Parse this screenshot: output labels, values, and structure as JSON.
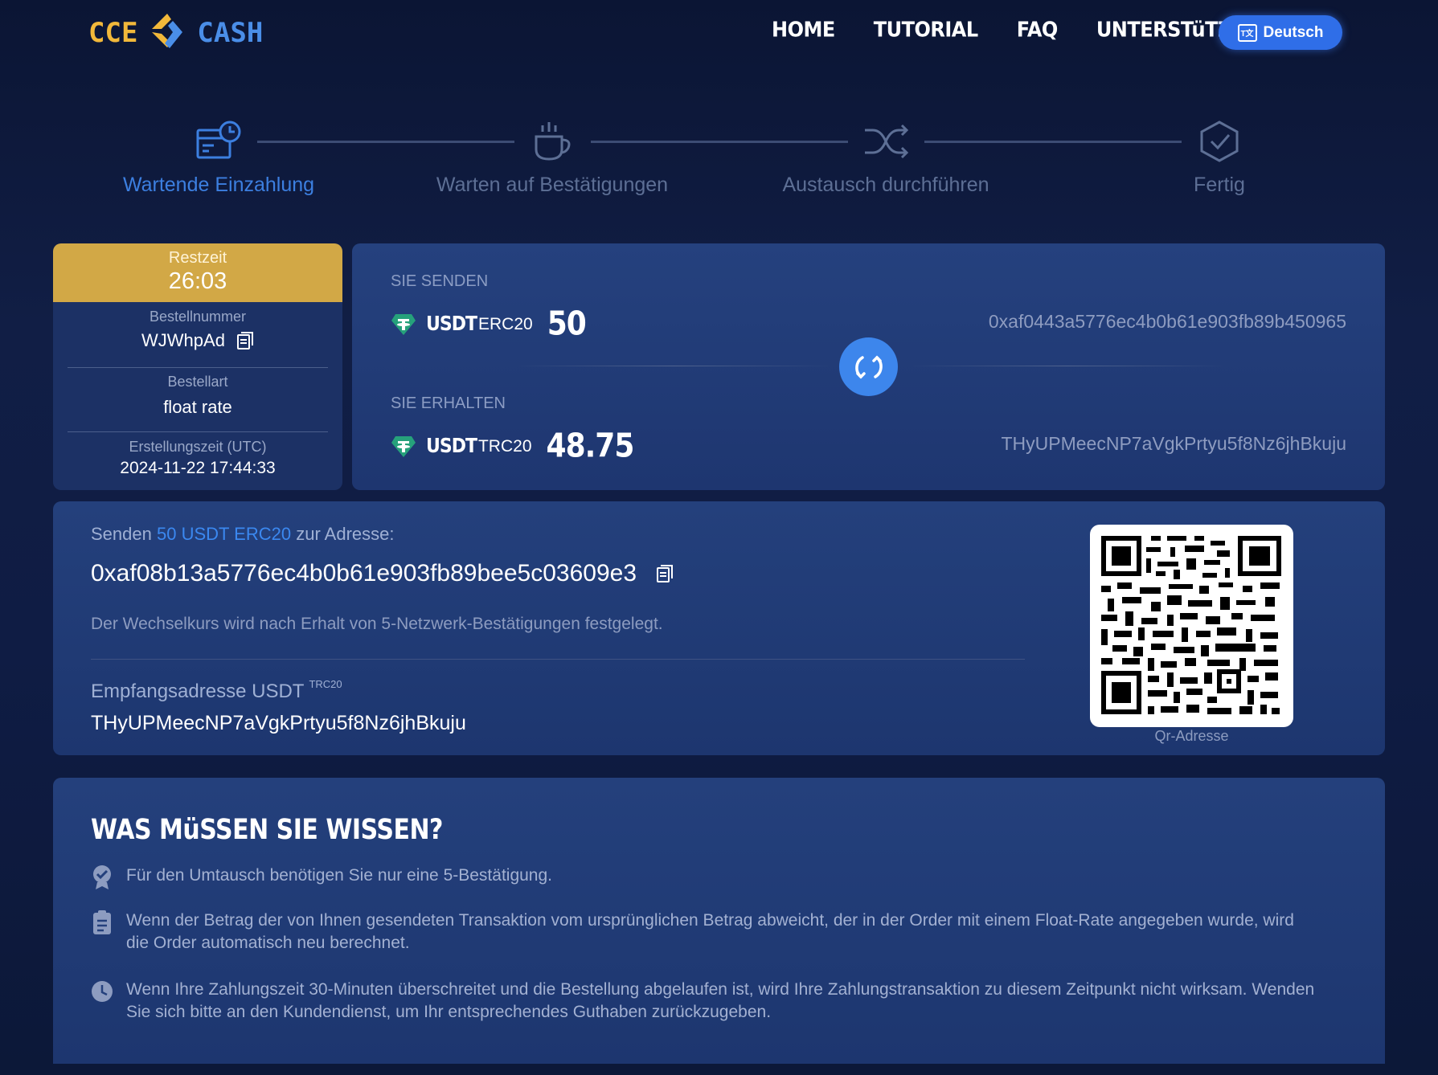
{
  "header": {
    "logo_left": "CCE",
    "logo_right": "CASH",
    "nav": [
      "HOME",
      "TUTORIAL",
      "FAQ",
      "UNTERSTüTZUNG"
    ],
    "language": "Deutsch",
    "language_icon": "language-icon"
  },
  "steps": [
    {
      "label": "Wartende Einzahlung",
      "icon": "deposit-clock-icon",
      "active": true
    },
    {
      "label": "Warten auf Bestätigungen",
      "icon": "coffee-cup-icon",
      "active": false
    },
    {
      "label": "Austausch durchführen",
      "icon": "shuffle-icon",
      "active": false
    },
    {
      "label": "Fertig",
      "icon": "check-shield-icon",
      "active": false
    }
  ],
  "order": {
    "timer_label": "Restzeit",
    "timer_value": "26:03",
    "order_number_label": "Bestellnummer",
    "order_number": "WJWhpAd",
    "order_type_label": "Bestellart",
    "order_type": "float rate",
    "created_label": "Erstellungszeit (UTC)",
    "created": "2024-11-22 17:44:33"
  },
  "exchange": {
    "send_label": "SIE SENDEN",
    "send_coin": "USDT",
    "send_network": "ERC20",
    "send_amount": "50",
    "send_address": "0xaf0443a5776ec4b0b61e903fb89b450965",
    "receive_label": "SIE ERHALTEN",
    "receive_coin": "USDT",
    "receive_network": "TRC20",
    "receive_amount": "48.75",
    "receive_address": "THyUPMeecNP7aVgkPrtyu5f8Nz6jhBkuju"
  },
  "deposit": {
    "send_prefix": "Senden",
    "send_amount": "50 USDT ERC20",
    "send_suffix": "zur Adresse:",
    "address": "0xaf08b13a5776ec4b0b61e903fb89bee5c03609e3",
    "note": "Der Wechselkurs wird nach Erhalt von 5-Netzwerk-Bestätigungen festgelegt.",
    "recv_label": "Empfangsadresse USDT",
    "recv_network": "TRC20",
    "recv_address": "THyUPMeecNP7aVgkPrtyu5f8Nz6jhBkuju",
    "qr_label": "Qr-Adresse"
  },
  "info": {
    "title": "WAS MüSSEN SIE WISSEN?",
    "items": [
      {
        "icon": "badge-check-icon",
        "text": "Für den Umtausch benötigen Sie nur eine 5-Bestätigung."
      },
      {
        "icon": "clipboard-icon",
        "text": "Wenn der Betrag der von Ihnen gesendeten Transaktion vom ursprünglichen Betrag abweicht, der in der Order mit einem Float-Rate angegeben wurde, wird die Order automatisch neu berechnet."
      },
      {
        "icon": "clock-icon",
        "text": "Wenn Ihre Zahlungszeit 30-Minuten überschreitet und die Bestellung abgelaufen ist, wird Ihre Zahlungstransaktion zu diesem Zeitpunkt nicht wirksam. Wenden Sie sich bitte an den Kundendienst, um Ihr entsprechendes Guthaben zurückzugeben."
      }
    ]
  },
  "colors": {
    "accent": "#3d86ec",
    "timer": "#d2a846",
    "tether": "#26a17b",
    "background": "#0f1c44"
  }
}
